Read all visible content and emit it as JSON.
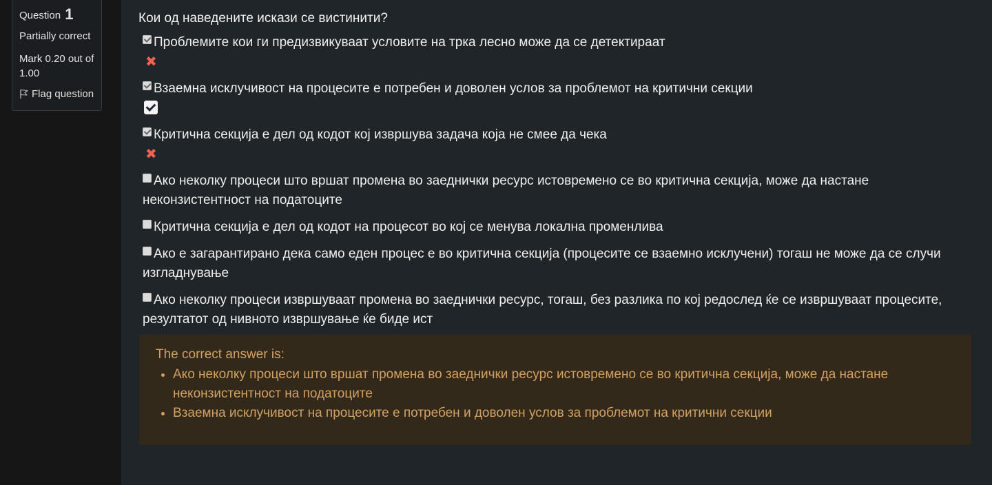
{
  "info": {
    "question_label": "Question",
    "question_number": "1",
    "state": "Partially correct",
    "grade_line1": "Mark 0.20 out of",
    "grade_line2": "1.00",
    "flag_label": "Flag question"
  },
  "question": {
    "text": "Кои од наведените искази се вистинити?",
    "options": [
      {
        "label": "Проблемите кои ги предизвикуваат условите на трка лесно може да се детектираат",
        "checked": true,
        "feedback": "incorrect"
      },
      {
        "label": "Взаемна исклучивост на процесите е потребен и доволен услов за проблемот на критични секции",
        "checked": true,
        "feedback": "correct"
      },
      {
        "label": "Критична секција е дел од кодот кој извршува задача која не смее да чека",
        "checked": true,
        "feedback": "incorrect"
      },
      {
        "label_line1": "Ако неколку процеси  што вршат промена во заеднички ресурс истовремено се во критична секција, може да настане",
        "label_line2": "неконзистентност на податоците",
        "checked": false
      },
      {
        "label": "Критична секција е дел од кодот на процесот во кој се менува локална променлива",
        "checked": false
      },
      {
        "label_line1": "Ако е загарантирано дека само еден процес е во критична секција (процесите се взаемно исклучени) тогаш не може да се случи",
        "label_line2": "изгладнување",
        "checked": false
      },
      {
        "label_line1": "Ако неколку процеси извршуваат промена во заеднички ресурс, тогаш, без разлика по кој редослед ќе се извршуваат процесите,",
        "label_line2": "резултатот од нивното извршување ќе биде ист",
        "checked": false
      }
    ]
  },
  "right_answer": {
    "lead": "The correct answer is:",
    "items": [
      {
        "line1": "Ако неколку процеси  што вршат промена во заеднички ресурс истовремено се во критична секција, може да настане",
        "line2": "неконзистентност на податоците"
      },
      {
        "line1": "Взаемна исклучивост на процесите е потребен и доволен услов за проблемот на критични секции"
      }
    ]
  },
  "colors": {
    "page_bg": "#161616",
    "content_bg": "#1f2528",
    "feedback_bg": "#33291a",
    "feedback_text": "#d3a063",
    "incorrect_mark": "#f0614f"
  },
  "icons": {
    "flag": "flag-icon",
    "incorrect": "cross-icon",
    "correct": "check-icon"
  }
}
